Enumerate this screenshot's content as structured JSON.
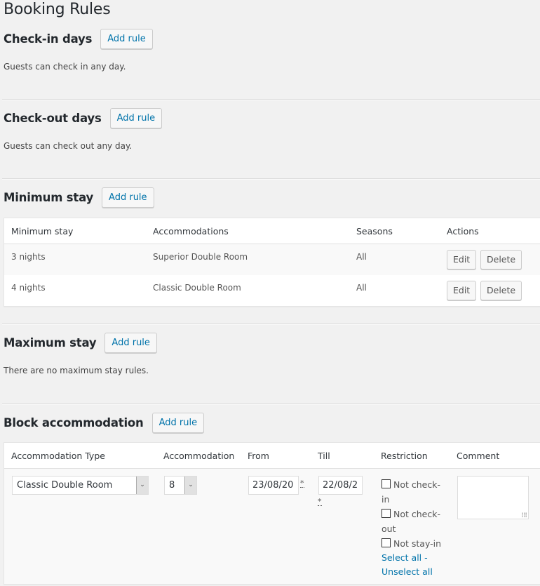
{
  "page": {
    "title": "Booking Rules"
  },
  "colors": {
    "background": "#f1f1f1",
    "link": "#0073aa",
    "heading": "#23282d"
  },
  "sections": {
    "checkin": {
      "title": "Check-in days",
      "add_label": "Add rule",
      "description": "Guests can check in any day."
    },
    "checkout": {
      "title": "Check-out days",
      "add_label": "Add rule",
      "description": "Guests can check out any day."
    },
    "min_stay": {
      "title": "Minimum stay",
      "add_label": "Add rule",
      "columns": [
        "Minimum stay",
        "Accommodations",
        "Seasons",
        "Actions"
      ],
      "rows": [
        {
          "stay": "3 nights",
          "accommodations": "Superior Double Room",
          "seasons": "All",
          "edit_label": "Edit",
          "delete_label": "Delete"
        },
        {
          "stay": "4 nights",
          "accommodations": "Classic Double Room",
          "seasons": "All",
          "edit_label": "Edit",
          "delete_label": "Delete"
        }
      ]
    },
    "max_stay": {
      "title": "Maximum stay",
      "add_label": "Add rule",
      "description": "There are no maximum stay rules."
    },
    "block": {
      "title": "Block accommodation",
      "add_label": "Add rule",
      "columns": [
        "Accommodation Type",
        "Accommodation",
        "From",
        "Till",
        "Restriction",
        "Comment"
      ],
      "row": {
        "accommodation_type": "Classic Double Room",
        "accommodation": "8",
        "from": "23/08/20",
        "till": "22/08/2",
        "required_marker": "*",
        "restrictions": [
          {
            "label": "Not check-in",
            "checked": false
          },
          {
            "label": "Not check-out",
            "checked": false
          },
          {
            "label": "Not stay-in",
            "checked": false
          }
        ],
        "select_all_label": "Select all",
        "separator": "-",
        "unselect_all_label": "Unselect all",
        "comment": ""
      }
    }
  }
}
